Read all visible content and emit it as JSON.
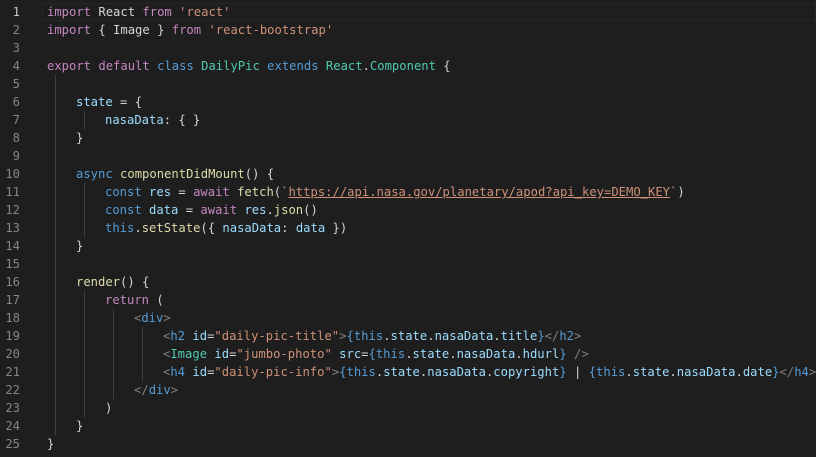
{
  "editor": {
    "active_line": 1,
    "lines": [
      {
        "n": "1",
        "indent": 0,
        "tokens": [
          {
            "c": "kw",
            "t": "import"
          },
          {
            "c": "txt",
            "t": " React "
          },
          {
            "c": "kw",
            "t": "from"
          },
          {
            "c": "txt",
            "t": " "
          },
          {
            "c": "str",
            "t": "'react'"
          }
        ]
      },
      {
        "n": "2",
        "indent": 0,
        "tokens": [
          {
            "c": "kw",
            "t": "import"
          },
          {
            "c": "txt",
            "t": " { Image } "
          },
          {
            "c": "kw",
            "t": "from"
          },
          {
            "c": "txt",
            "t": " "
          },
          {
            "c": "str",
            "t": "'react-bootstrap'"
          }
        ]
      },
      {
        "n": "3",
        "indent": 0,
        "tokens": []
      },
      {
        "n": "4",
        "indent": 0,
        "tokens": [
          {
            "c": "kw",
            "t": "export"
          },
          {
            "c": "txt",
            "t": " "
          },
          {
            "c": "kw",
            "t": "default"
          },
          {
            "c": "txt",
            "t": " "
          },
          {
            "c": "sk",
            "t": "class"
          },
          {
            "c": "txt",
            "t": " "
          },
          {
            "c": "cls",
            "t": "DailyPic"
          },
          {
            "c": "txt",
            "t": " "
          },
          {
            "c": "sk",
            "t": "extends"
          },
          {
            "c": "txt",
            "t": " "
          },
          {
            "c": "cls",
            "t": "React"
          },
          {
            "c": "txt",
            "t": "."
          },
          {
            "c": "cls",
            "t": "Component"
          },
          {
            "c": "txt",
            "t": " {"
          }
        ]
      },
      {
        "n": "5",
        "indent": 1,
        "tokens": []
      },
      {
        "n": "6",
        "indent": 1,
        "tokens": [
          {
            "c": "var",
            "t": "state"
          },
          {
            "c": "txt",
            "t": " = {"
          }
        ]
      },
      {
        "n": "7",
        "indent": 2,
        "tokens": [
          {
            "c": "var",
            "t": "nasaData"
          },
          {
            "c": "txt",
            "t": ": { }"
          }
        ]
      },
      {
        "n": "8",
        "indent": 1,
        "tokens": [
          {
            "c": "txt",
            "t": "}"
          }
        ]
      },
      {
        "n": "9",
        "indent": 1,
        "tokens": []
      },
      {
        "n": "10",
        "indent": 1,
        "tokens": [
          {
            "c": "sk",
            "t": "async"
          },
          {
            "c": "txt",
            "t": " "
          },
          {
            "c": "fn",
            "t": "componentDidMount"
          },
          {
            "c": "txt",
            "t": "() {"
          }
        ]
      },
      {
        "n": "11",
        "indent": 2,
        "tokens": [
          {
            "c": "sk",
            "t": "const"
          },
          {
            "c": "txt",
            "t": " "
          },
          {
            "c": "var",
            "t": "res"
          },
          {
            "c": "txt",
            "t": " = "
          },
          {
            "c": "kw",
            "t": "await"
          },
          {
            "c": "txt",
            "t": " "
          },
          {
            "c": "fn",
            "t": "fetch"
          },
          {
            "c": "txt",
            "t": "("
          },
          {
            "c": "str",
            "t": "`"
          },
          {
            "c": "url",
            "t": "https://api.nasa.gov/planetary/apod?api_key=DEMO_KEY"
          },
          {
            "c": "str",
            "t": "`"
          },
          {
            "c": "txt",
            "t": ")"
          }
        ]
      },
      {
        "n": "12",
        "indent": 2,
        "tokens": [
          {
            "c": "sk",
            "t": "const"
          },
          {
            "c": "txt",
            "t": " "
          },
          {
            "c": "var",
            "t": "data"
          },
          {
            "c": "txt",
            "t": " = "
          },
          {
            "c": "kw",
            "t": "await"
          },
          {
            "c": "txt",
            "t": " "
          },
          {
            "c": "var",
            "t": "res"
          },
          {
            "c": "txt",
            "t": "."
          },
          {
            "c": "fn",
            "t": "json"
          },
          {
            "c": "txt",
            "t": "()"
          }
        ]
      },
      {
        "n": "13",
        "indent": 2,
        "tokens": [
          {
            "c": "sk",
            "t": "this"
          },
          {
            "c": "txt",
            "t": "."
          },
          {
            "c": "fn",
            "t": "setState"
          },
          {
            "c": "txt",
            "t": "({ "
          },
          {
            "c": "var",
            "t": "nasaData"
          },
          {
            "c": "txt",
            "t": ": "
          },
          {
            "c": "var",
            "t": "data"
          },
          {
            "c": "txt",
            "t": " })"
          }
        ]
      },
      {
        "n": "14",
        "indent": 1,
        "tokens": [
          {
            "c": "txt",
            "t": "}"
          }
        ]
      },
      {
        "n": "15",
        "indent": 1,
        "tokens": []
      },
      {
        "n": "16",
        "indent": 1,
        "tokens": [
          {
            "c": "fn",
            "t": "render"
          },
          {
            "c": "txt",
            "t": "() {"
          }
        ]
      },
      {
        "n": "17",
        "indent": 2,
        "tokens": [
          {
            "c": "kw",
            "t": "return"
          },
          {
            "c": "txt",
            "t": " ("
          }
        ]
      },
      {
        "n": "18",
        "indent": 3,
        "tokens": [
          {
            "c": "pun",
            "t": "<"
          },
          {
            "c": "tag",
            "t": "div"
          },
          {
            "c": "pun",
            "t": ">"
          }
        ]
      },
      {
        "n": "19",
        "indent": 4,
        "tokens": [
          {
            "c": "pun",
            "t": "<"
          },
          {
            "c": "tag",
            "t": "h2"
          },
          {
            "c": "txt",
            "t": " "
          },
          {
            "c": "attr",
            "t": "id"
          },
          {
            "c": "txt",
            "t": "="
          },
          {
            "c": "str",
            "t": "\"daily-pic-title\""
          },
          {
            "c": "pun",
            "t": ">"
          },
          {
            "c": "sk",
            "t": "{"
          },
          {
            "c": "sk",
            "t": "this"
          },
          {
            "c": "txt",
            "t": "."
          },
          {
            "c": "var",
            "t": "state"
          },
          {
            "c": "txt",
            "t": "."
          },
          {
            "c": "var",
            "t": "nasaData"
          },
          {
            "c": "txt",
            "t": "."
          },
          {
            "c": "var",
            "t": "title"
          },
          {
            "c": "sk",
            "t": "}"
          },
          {
            "c": "pun",
            "t": "</"
          },
          {
            "c": "tag",
            "t": "h2"
          },
          {
            "c": "pun",
            "t": ">"
          }
        ]
      },
      {
        "n": "20",
        "indent": 4,
        "tokens": [
          {
            "c": "pun",
            "t": "<"
          },
          {
            "c": "cls",
            "t": "Image"
          },
          {
            "c": "txt",
            "t": " "
          },
          {
            "c": "attr",
            "t": "id"
          },
          {
            "c": "txt",
            "t": "="
          },
          {
            "c": "str",
            "t": "\"jumbo-photo\""
          },
          {
            "c": "txt",
            "t": " "
          },
          {
            "c": "attr",
            "t": "src"
          },
          {
            "c": "txt",
            "t": "="
          },
          {
            "c": "sk",
            "t": "{"
          },
          {
            "c": "sk",
            "t": "this"
          },
          {
            "c": "txt",
            "t": "."
          },
          {
            "c": "var",
            "t": "state"
          },
          {
            "c": "txt",
            "t": "."
          },
          {
            "c": "var",
            "t": "nasaData"
          },
          {
            "c": "txt",
            "t": "."
          },
          {
            "c": "var",
            "t": "hdurl"
          },
          {
            "c": "sk",
            "t": "}"
          },
          {
            "c": "txt",
            "t": " "
          },
          {
            "c": "pun",
            "t": "/>"
          }
        ]
      },
      {
        "n": "21",
        "indent": 4,
        "tokens": [
          {
            "c": "pun",
            "t": "<"
          },
          {
            "c": "tag",
            "t": "h4"
          },
          {
            "c": "txt",
            "t": " "
          },
          {
            "c": "attr",
            "t": "id"
          },
          {
            "c": "txt",
            "t": "="
          },
          {
            "c": "str",
            "t": "\"daily-pic-info\""
          },
          {
            "c": "pun",
            "t": ">"
          },
          {
            "c": "sk",
            "t": "{"
          },
          {
            "c": "sk",
            "t": "this"
          },
          {
            "c": "txt",
            "t": "."
          },
          {
            "c": "var",
            "t": "state"
          },
          {
            "c": "txt",
            "t": "."
          },
          {
            "c": "var",
            "t": "nasaData"
          },
          {
            "c": "txt",
            "t": "."
          },
          {
            "c": "var",
            "t": "copyright"
          },
          {
            "c": "sk",
            "t": "}"
          },
          {
            "c": "txt",
            "t": " | "
          },
          {
            "c": "sk",
            "t": "{"
          },
          {
            "c": "sk",
            "t": "this"
          },
          {
            "c": "txt",
            "t": "."
          },
          {
            "c": "var",
            "t": "state"
          },
          {
            "c": "txt",
            "t": "."
          },
          {
            "c": "var",
            "t": "nasaData"
          },
          {
            "c": "txt",
            "t": "."
          },
          {
            "c": "var",
            "t": "date"
          },
          {
            "c": "sk",
            "t": "}"
          },
          {
            "c": "pun",
            "t": "</"
          },
          {
            "c": "tag",
            "t": "h4"
          },
          {
            "c": "pun",
            "t": ">"
          }
        ]
      },
      {
        "n": "22",
        "indent": 3,
        "tokens": [
          {
            "c": "pun",
            "t": "</"
          },
          {
            "c": "tag",
            "t": "div"
          },
          {
            "c": "pun",
            "t": ">"
          }
        ]
      },
      {
        "n": "23",
        "indent": 2,
        "tokens": [
          {
            "c": "txt",
            "t": ")"
          }
        ]
      },
      {
        "n": "24",
        "indent": 1,
        "tokens": [
          {
            "c": "txt",
            "t": "}"
          }
        ]
      },
      {
        "n": "25",
        "indent": 0,
        "tokens": [
          {
            "c": "txt",
            "t": "}"
          }
        ]
      }
    ]
  }
}
